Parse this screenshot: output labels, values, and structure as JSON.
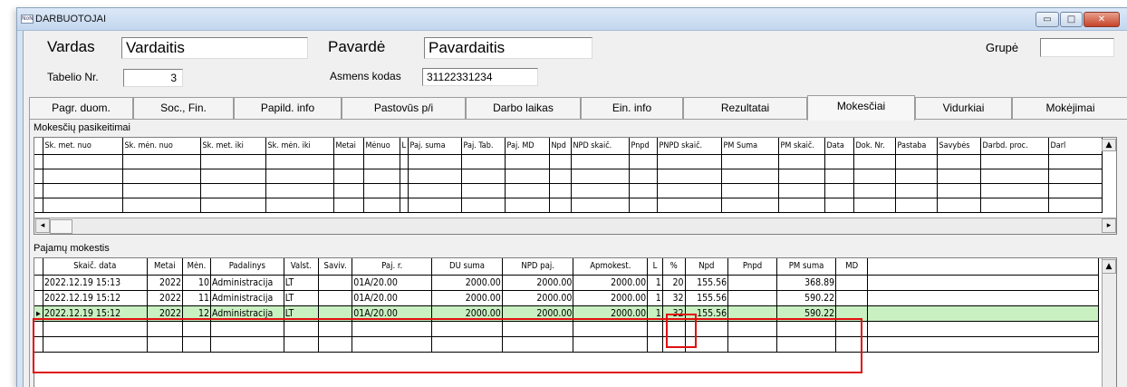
{
  "window": {
    "icon_text": "NoNO",
    "title": "DARBUOTOJAI",
    "buttons": {
      "minimize": "▭",
      "maximize": "□",
      "close": "✕"
    }
  },
  "form": {
    "vardas_label": "Vardas",
    "vardas_value": "Vardaitis",
    "pavarde_label": "Pavardė",
    "pavarde_value": "Pavardaitis",
    "grupe_label": "Grupė",
    "grupe_value": "",
    "tabelio_label": "Tabelio Nr.",
    "tabelio_value": "3",
    "asmens_label": "Asmens kodas",
    "asmens_value": "31122331234"
  },
  "tabs": [
    {
      "label": "Pagr. duom."
    },
    {
      "label": "Soc., Fin."
    },
    {
      "label": "Papild. info"
    },
    {
      "label": "Pastovūs p/i"
    },
    {
      "label": "Darbo laikas"
    },
    {
      "label": "Ein. info"
    },
    {
      "label": "Rezultatai"
    },
    {
      "label": "Mokesčiai"
    },
    {
      "label": "Vidurkiai"
    },
    {
      "label": "Mokėjimai"
    }
  ],
  "tax_changes": {
    "title": "Mokesčių pasikeitimai",
    "columns": [
      "Sk. met. nuo",
      "Sk. mėn. nuo",
      "Sk. met. iki",
      "Sk. mėn. iki",
      "Metai",
      "Mėnuo",
      "L",
      "Paj. suma",
      "Paj. Tab.",
      "Paj. MD",
      "Npd",
      "NPD skaič.",
      "Pnpd",
      "PNPD skaič.",
      "PM Suma",
      "PM skaič.",
      "Data",
      "Dok. Nr.",
      "Pastaba",
      "Savybės",
      "Darbd. proc.",
      "Darl"
    ]
  },
  "income_tax": {
    "title": "Pajamų mokestis",
    "columns": [
      "Skaič. data",
      "Metai",
      "Mėn.",
      "Padalinys",
      "Valst.",
      "Saviv.",
      "Paj. r.",
      "DU suma",
      "NPD paj.",
      "Apmokest.",
      "L",
      "%",
      "Npd",
      "Pnpd",
      "PM suma",
      "MD",
      ""
    ],
    "rows": [
      [
        "2022.12.19 15:13",
        "2022",
        "10",
        "Administracija",
        "LT",
        "",
        "01A/20.00",
        "2000.00",
        "2000.00",
        "2000.00",
        "1",
        "20",
        "155.56",
        "",
        "368.89",
        "",
        ""
      ],
      [
        "2022.12.19 15:12",
        "2022",
        "11",
        "Administracija",
        "LT",
        "",
        "01A/20.00",
        "2000.00",
        "2000.00",
        "2000.00",
        "1",
        "32",
        "155.56",
        "",
        "590.22",
        "",
        ""
      ],
      [
        "2022.12.19 15:12",
        "2022",
        "12",
        "Administracija",
        "LT",
        "",
        "01A/20.00",
        "2000.00",
        "2000.00",
        "2000.00",
        "1",
        "32",
        "155.56",
        "",
        "590.22",
        "",
        ""
      ]
    ],
    "selected_row": 2,
    "row_indicator": "▸"
  },
  "scroll": {
    "up": "▲",
    "left": "◂",
    "right": "▸"
  },
  "colors": {
    "selected_row": "#c8f0c0",
    "highlight": "#e01010",
    "window_frame": "#d4e3f5"
  }
}
